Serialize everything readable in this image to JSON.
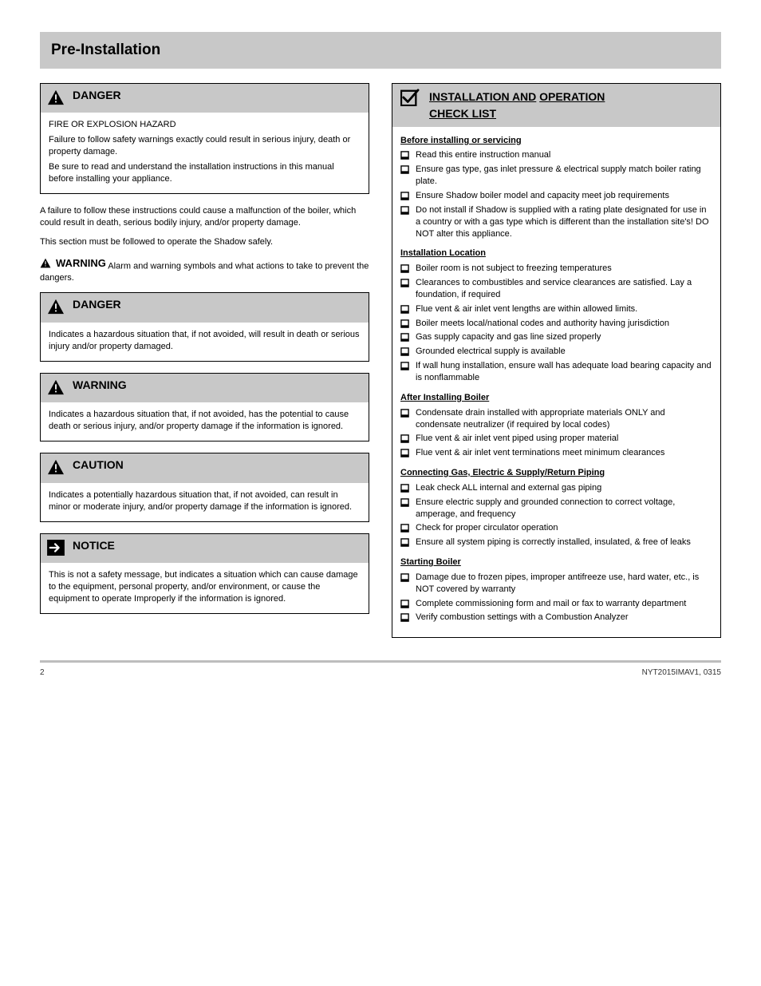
{
  "title": "Pre-Installation",
  "danger": {
    "heading": "DANGER",
    "lines": [
      "FIRE OR EXPLOSION HAZARD",
      "Failure to follow safety warnings exactly could result in serious injury, death or property damage.",
      "Be sure to read and understand the installation instructions in this manual before installing your appliance."
    ]
  },
  "intro1": "A failure to follow these instructions could cause a malfunction of the boiler, which could result in death, serious bodily injury, and/or property damage.",
  "intro2": "This section must be followed to operate the Shadow safely.",
  "inline_warning": {
    "label": "WARNING",
    "text": "Alarm and warning symbols and what actions to take to prevent the dangers."
  },
  "danger_def": {
    "heading": "DANGER",
    "body": "Indicates a hazardous situation that, if not avoided, will result in death or serious injury and/or property damaged."
  },
  "warning_def": {
    "heading": "WARNING",
    "body": "Indicates a hazardous situation that, if not avoided, has the potential to cause death or serious injury, and/or property damage if the information is ignored."
  },
  "caution_def": {
    "heading": "CAUTION",
    "body": "Indicates a potentially hazardous situation that, if not avoided, can result in minor or moderate injury, and/or property damage if the information is ignored."
  },
  "notice_def": {
    "heading": "NOTICE",
    "body": "This is not a safety message, but indicates a situation which can cause damage to the equipment, personal property, and/or environment, or cause the equipment to operate Improperly if the information is ignored."
  },
  "checklist": {
    "title_line1": "INSTALLATION AND",
    "title_line2": "OPERATION",
    "title_line3": "CHECK LIST",
    "sections": [
      {
        "heading": "Before installing or servicing",
        "items": [
          "Read this entire instruction manual",
          "Ensure gas type, gas inlet pressure & electrical supply match boiler rating plate.",
          "Ensure Shadow boiler model and capacity meet job requirements",
          "Do not install if Shadow is supplied with a rating plate designated for use in a country or with a gas type which is different than the installation site's! DO NOT alter this appliance."
        ]
      },
      {
        "heading": "Installation Location",
        "items": [
          "Boiler room is not subject to freezing temperatures",
          "Clearances to combustibles and service clearances are satisfied. Lay a foundation, if required",
          "Flue vent & air inlet vent lengths are within allowed limits.",
          "Boiler meets local/national codes and authority having jurisdiction",
          "Gas supply capacity and gas line sized properly",
          "Grounded electrical supply is available",
          "If wall hung installation, ensure wall has adequate load bearing capacity and is nonflammable"
        ]
      },
      {
        "heading": "After Installing Boiler",
        "items": [
          "Condensate drain installed with appropriate materials ONLY and condensate neutralizer (if required by local codes)",
          "Flue vent & air inlet vent piped using proper material",
          "Flue vent & air inlet vent terminations meet minimum clearances"
        ]
      },
      {
        "heading": "Connecting Gas, Electric & Supply/Return Piping",
        "items": [
          "Leak check ALL internal and external gas piping",
          "Ensure electric supply and grounded connection to correct voltage, amperage, and frequency",
          "Check for proper circulator operation",
          "Ensure all system piping is correctly installed, insulated, & free of leaks"
        ]
      },
      {
        "heading": "Starting Boiler",
        "items": [
          "Damage due to frozen pipes, improper antifreeze use, hard water, etc., is NOT covered by warranty",
          "Complete commissioning form and mail or fax to warranty department",
          "Verify combustion settings with a Combustion Analyzer"
        ]
      }
    ]
  },
  "footer": {
    "left": "2",
    "right": "NYT2015IMAV1, 0315"
  }
}
